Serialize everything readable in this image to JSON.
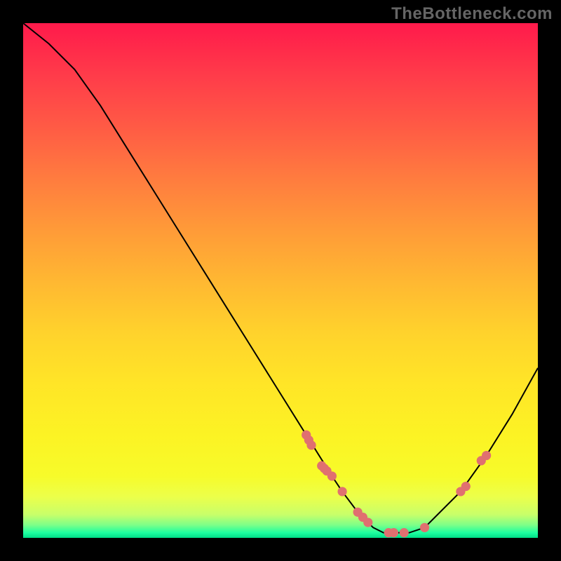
{
  "watermark": "TheBottleneck.com",
  "chart_data": {
    "type": "line",
    "title": "",
    "xlabel": "",
    "ylabel": "",
    "xlim": [
      0,
      100
    ],
    "ylim": [
      0,
      100
    ],
    "series": [
      {
        "name": "curve",
        "x": [
          0,
          5,
          10,
          15,
          20,
          25,
          30,
          35,
          40,
          45,
          50,
          55,
          60,
          62,
          65,
          68,
          70,
          72,
          75,
          78,
          80,
          85,
          90,
          95,
          100
        ],
        "y": [
          100,
          96,
          91,
          84,
          76,
          68,
          60,
          52,
          44,
          36,
          28,
          20,
          12,
          9,
          5,
          2,
          1,
          1,
          1,
          2,
          4,
          9,
          16,
          24,
          33
        ]
      },
      {
        "name": "points",
        "type": "scatter",
        "x": [
          55,
          55.5,
          56,
          58,
          58.5,
          59,
          60,
          62,
          65,
          66,
          67,
          71,
          72,
          74,
          78,
          85,
          86,
          89,
          90
        ],
        "y": [
          20,
          19,
          18,
          14,
          13.5,
          13,
          12,
          9,
          5,
          4,
          3,
          1,
          1,
          1,
          2,
          9,
          10,
          15,
          16
        ]
      }
    ],
    "gradient_bands": [
      {
        "stop": 0.0,
        "color": "#ff1a4b"
      },
      {
        "stop": 0.1,
        "color": "#ff3b4a"
      },
      {
        "stop": 0.2,
        "color": "#ff5a45"
      },
      {
        "stop": 0.3,
        "color": "#ff7b3f"
      },
      {
        "stop": 0.4,
        "color": "#ff9a38"
      },
      {
        "stop": 0.5,
        "color": "#ffb732"
      },
      {
        "stop": 0.6,
        "color": "#ffd22c"
      },
      {
        "stop": 0.7,
        "color": "#ffe527"
      },
      {
        "stop": 0.8,
        "color": "#fcf324"
      },
      {
        "stop": 0.88,
        "color": "#f7fb2a"
      },
      {
        "stop": 0.92,
        "color": "#ecff4a"
      },
      {
        "stop": 0.955,
        "color": "#c8ff6a"
      },
      {
        "stop": 0.975,
        "color": "#7dff88"
      },
      {
        "stop": 0.99,
        "color": "#1dffa0"
      },
      {
        "stop": 1.0,
        "color": "#00de88"
      }
    ],
    "point_color": "#e07070",
    "curve_color": "#000000"
  }
}
